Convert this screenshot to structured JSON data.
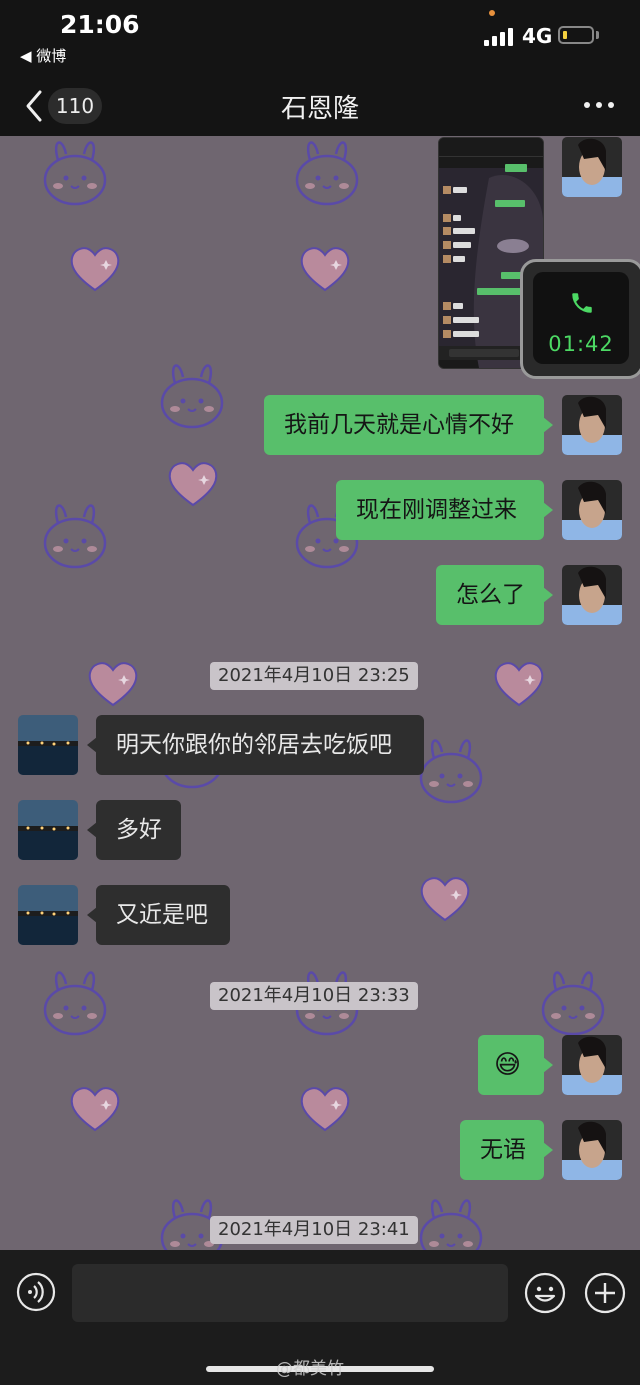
{
  "status_bar": {
    "time": "21:06",
    "back_app": "◀ 微博",
    "network": "4G",
    "battery_color": "#f4d03f"
  },
  "header": {
    "unread_count": "110",
    "title": "石恩隆",
    "back_icon": "chevron-left-icon",
    "more_icon": "more-dots-icon"
  },
  "call_float": {
    "duration": "01:42",
    "icon": "phone-icon",
    "color": "#4cd964"
  },
  "messages": [
    {
      "side": "out",
      "text": "我前几天就是心情不好"
    },
    {
      "side": "out",
      "text": "现在刚调整过来"
    },
    {
      "side": "out",
      "text": "怎么了"
    },
    {
      "type": "time",
      "text": "2021年4月10日 23:25"
    },
    {
      "side": "in",
      "text": "明天你跟你的邻居去吃饭吧"
    },
    {
      "side": "in",
      "text": "多好"
    },
    {
      "side": "in",
      "text": "又近是吧"
    },
    {
      "type": "time",
      "text": "2021年4月10日 23:33"
    },
    {
      "side": "out",
      "text": "😅"
    },
    {
      "side": "out",
      "text": "无语"
    },
    {
      "type": "time",
      "text": "2021年4月10日 23:41"
    }
  ],
  "input_bar": {
    "voice_icon": "voice-icon",
    "emoji_icon": "emoji-icon",
    "plus_icon": "plus-icon"
  },
  "watermark": "@都美竹",
  "colors": {
    "outgoing_bubble": "#58bf6b",
    "incoming_bubble": "#2e2e2e",
    "chat_background": "#6f6670"
  }
}
